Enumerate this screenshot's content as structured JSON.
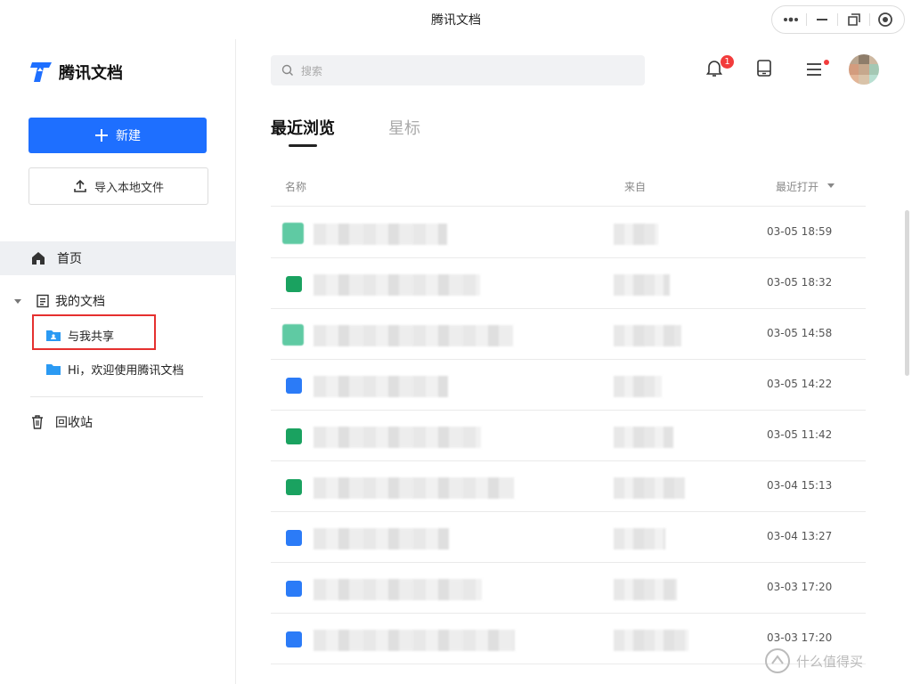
{
  "window": {
    "title": "腾讯文档"
  },
  "sidebar": {
    "logo_text": "腾讯文档",
    "new_label": "新建",
    "import_label": "导入本地文件",
    "home_label": "首页",
    "my_docs_label": "我的文档",
    "shared_label": "与我共享",
    "welcome_label": "Hi，欢迎使用腾讯文档",
    "trash_label": "回收站"
  },
  "search": {
    "placeholder": "搜索"
  },
  "notifications": {
    "count": "1"
  },
  "tabs": [
    {
      "label": "最近浏览"
    },
    {
      "label": "星标"
    }
  ],
  "table": {
    "headers": {
      "name": "名称",
      "from": "来自",
      "opened": "最近打开"
    },
    "rows": [
      {
        "time": "03-05 18:59",
        "type": "sheet-teal"
      },
      {
        "time": "03-05 18:32",
        "type": "sheet"
      },
      {
        "time": "03-05 14:58",
        "type": "sheet-teal"
      },
      {
        "time": "03-05 14:22",
        "type": "doc"
      },
      {
        "time": "03-05 11:42",
        "type": "sheet"
      },
      {
        "time": "03-04 15:13",
        "type": "sheet"
      },
      {
        "time": "03-04 13:27",
        "type": "doc"
      },
      {
        "time": "03-03 17:20",
        "type": "doc"
      },
      {
        "time": "03-03 17:20",
        "type": "doc"
      }
    ]
  },
  "watermark": {
    "text": "什么值得买"
  },
  "colors": {
    "accent": "#1e6fff",
    "sheet": "#1aa260",
    "doc": "#2b7bf7",
    "red": "#e5302f"
  }
}
